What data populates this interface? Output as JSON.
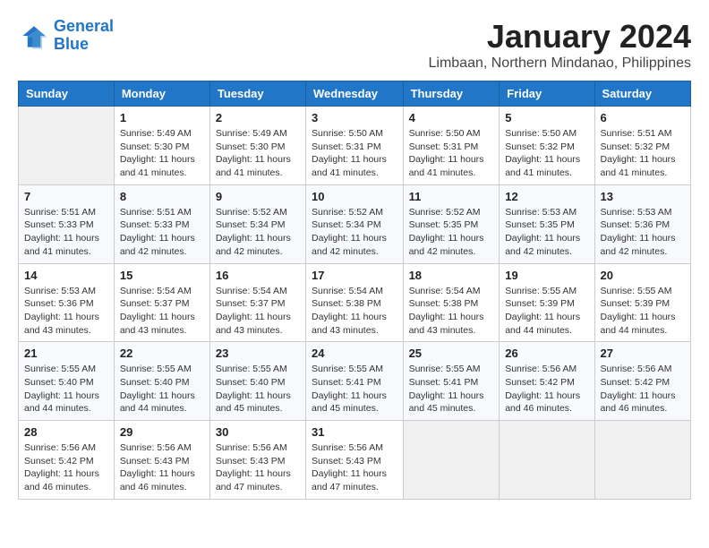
{
  "header": {
    "logo_line1": "General",
    "logo_line2": "Blue",
    "month_title": "January 2024",
    "location": "Limbaan, Northern Mindanao, Philippines"
  },
  "days_of_week": [
    "Sunday",
    "Monday",
    "Tuesday",
    "Wednesday",
    "Thursday",
    "Friday",
    "Saturday"
  ],
  "weeks": [
    [
      {
        "day": "",
        "info": ""
      },
      {
        "day": "1",
        "info": "Sunrise: 5:49 AM\nSunset: 5:30 PM\nDaylight: 11 hours\nand 41 minutes."
      },
      {
        "day": "2",
        "info": "Sunrise: 5:49 AM\nSunset: 5:30 PM\nDaylight: 11 hours\nand 41 minutes."
      },
      {
        "day": "3",
        "info": "Sunrise: 5:50 AM\nSunset: 5:31 PM\nDaylight: 11 hours\nand 41 minutes."
      },
      {
        "day": "4",
        "info": "Sunrise: 5:50 AM\nSunset: 5:31 PM\nDaylight: 11 hours\nand 41 minutes."
      },
      {
        "day": "5",
        "info": "Sunrise: 5:50 AM\nSunset: 5:32 PM\nDaylight: 11 hours\nand 41 minutes."
      },
      {
        "day": "6",
        "info": "Sunrise: 5:51 AM\nSunset: 5:32 PM\nDaylight: 11 hours\nand 41 minutes."
      }
    ],
    [
      {
        "day": "7",
        "info": "Sunrise: 5:51 AM\nSunset: 5:33 PM\nDaylight: 11 hours\nand 41 minutes."
      },
      {
        "day": "8",
        "info": "Sunrise: 5:51 AM\nSunset: 5:33 PM\nDaylight: 11 hours\nand 42 minutes."
      },
      {
        "day": "9",
        "info": "Sunrise: 5:52 AM\nSunset: 5:34 PM\nDaylight: 11 hours\nand 42 minutes."
      },
      {
        "day": "10",
        "info": "Sunrise: 5:52 AM\nSunset: 5:34 PM\nDaylight: 11 hours\nand 42 minutes."
      },
      {
        "day": "11",
        "info": "Sunrise: 5:52 AM\nSunset: 5:35 PM\nDaylight: 11 hours\nand 42 minutes."
      },
      {
        "day": "12",
        "info": "Sunrise: 5:53 AM\nSunset: 5:35 PM\nDaylight: 11 hours\nand 42 minutes."
      },
      {
        "day": "13",
        "info": "Sunrise: 5:53 AM\nSunset: 5:36 PM\nDaylight: 11 hours\nand 42 minutes."
      }
    ],
    [
      {
        "day": "14",
        "info": "Sunrise: 5:53 AM\nSunset: 5:36 PM\nDaylight: 11 hours\nand 43 minutes."
      },
      {
        "day": "15",
        "info": "Sunrise: 5:54 AM\nSunset: 5:37 PM\nDaylight: 11 hours\nand 43 minutes."
      },
      {
        "day": "16",
        "info": "Sunrise: 5:54 AM\nSunset: 5:37 PM\nDaylight: 11 hours\nand 43 minutes."
      },
      {
        "day": "17",
        "info": "Sunrise: 5:54 AM\nSunset: 5:38 PM\nDaylight: 11 hours\nand 43 minutes."
      },
      {
        "day": "18",
        "info": "Sunrise: 5:54 AM\nSunset: 5:38 PM\nDaylight: 11 hours\nand 43 minutes."
      },
      {
        "day": "19",
        "info": "Sunrise: 5:55 AM\nSunset: 5:39 PM\nDaylight: 11 hours\nand 44 minutes."
      },
      {
        "day": "20",
        "info": "Sunrise: 5:55 AM\nSunset: 5:39 PM\nDaylight: 11 hours\nand 44 minutes."
      }
    ],
    [
      {
        "day": "21",
        "info": "Sunrise: 5:55 AM\nSunset: 5:40 PM\nDaylight: 11 hours\nand 44 minutes."
      },
      {
        "day": "22",
        "info": "Sunrise: 5:55 AM\nSunset: 5:40 PM\nDaylight: 11 hours\nand 44 minutes."
      },
      {
        "day": "23",
        "info": "Sunrise: 5:55 AM\nSunset: 5:40 PM\nDaylight: 11 hours\nand 45 minutes."
      },
      {
        "day": "24",
        "info": "Sunrise: 5:55 AM\nSunset: 5:41 PM\nDaylight: 11 hours\nand 45 minutes."
      },
      {
        "day": "25",
        "info": "Sunrise: 5:55 AM\nSunset: 5:41 PM\nDaylight: 11 hours\nand 45 minutes."
      },
      {
        "day": "26",
        "info": "Sunrise: 5:56 AM\nSunset: 5:42 PM\nDaylight: 11 hours\nand 46 minutes."
      },
      {
        "day": "27",
        "info": "Sunrise: 5:56 AM\nSunset: 5:42 PM\nDaylight: 11 hours\nand 46 minutes."
      }
    ],
    [
      {
        "day": "28",
        "info": "Sunrise: 5:56 AM\nSunset: 5:42 PM\nDaylight: 11 hours\nand 46 minutes."
      },
      {
        "day": "29",
        "info": "Sunrise: 5:56 AM\nSunset: 5:43 PM\nDaylight: 11 hours\nand 46 minutes."
      },
      {
        "day": "30",
        "info": "Sunrise: 5:56 AM\nSunset: 5:43 PM\nDaylight: 11 hours\nand 47 minutes."
      },
      {
        "day": "31",
        "info": "Sunrise: 5:56 AM\nSunset: 5:43 PM\nDaylight: 11 hours\nand 47 minutes."
      },
      {
        "day": "",
        "info": ""
      },
      {
        "day": "",
        "info": ""
      },
      {
        "day": "",
        "info": ""
      }
    ]
  ]
}
